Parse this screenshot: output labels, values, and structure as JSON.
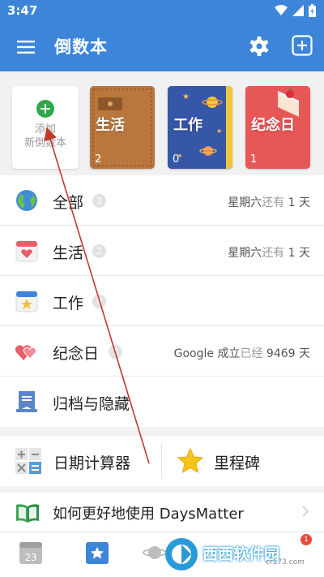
{
  "status": {
    "time": "3:47"
  },
  "appbar": {
    "title": "倒数本"
  },
  "books": {
    "add_label_line1": "添加",
    "add_label_line2": "新倒数本",
    "items": [
      {
        "name": "生活",
        "count": "2"
      },
      {
        "name": "工作",
        "count": "0"
      },
      {
        "name": "纪念日",
        "count": "1"
      }
    ]
  },
  "list": {
    "rows": [
      {
        "name": "全部",
        "badge": "3",
        "weekday": "星期六",
        "rel": "还有",
        "days": "1 天",
        "icon": "globe-icon"
      },
      {
        "name": "生活",
        "badge": "2",
        "weekday": "星期六",
        "rel": "还有",
        "days": "1 天",
        "icon": "heart-calendar-icon"
      },
      {
        "name": "工作",
        "badge": "0",
        "icon": "star-calendar-icon"
      },
      {
        "name": "纪念日",
        "badge": "1",
        "weekday": "Google 成立",
        "rel": "已经",
        "days": "9469 天",
        "icon": "hearts-icon"
      },
      {
        "name": "归档与隐藏",
        "icon": "archive-icon"
      }
    ]
  },
  "tools": {
    "calculator_label": "日期计算器",
    "milestone_label": "里程碑"
  },
  "help": {
    "text": "如何更好地使用 DaysMatter"
  },
  "nav": {
    "calendar_day": "23",
    "badge": "1"
  },
  "watermark": {
    "text": "西西软件园",
    "sub": "cr173.com"
  },
  "colors": {
    "primary": "#3d85d9",
    "add_green": "#2fa84a",
    "annotation": "#c0392b"
  }
}
